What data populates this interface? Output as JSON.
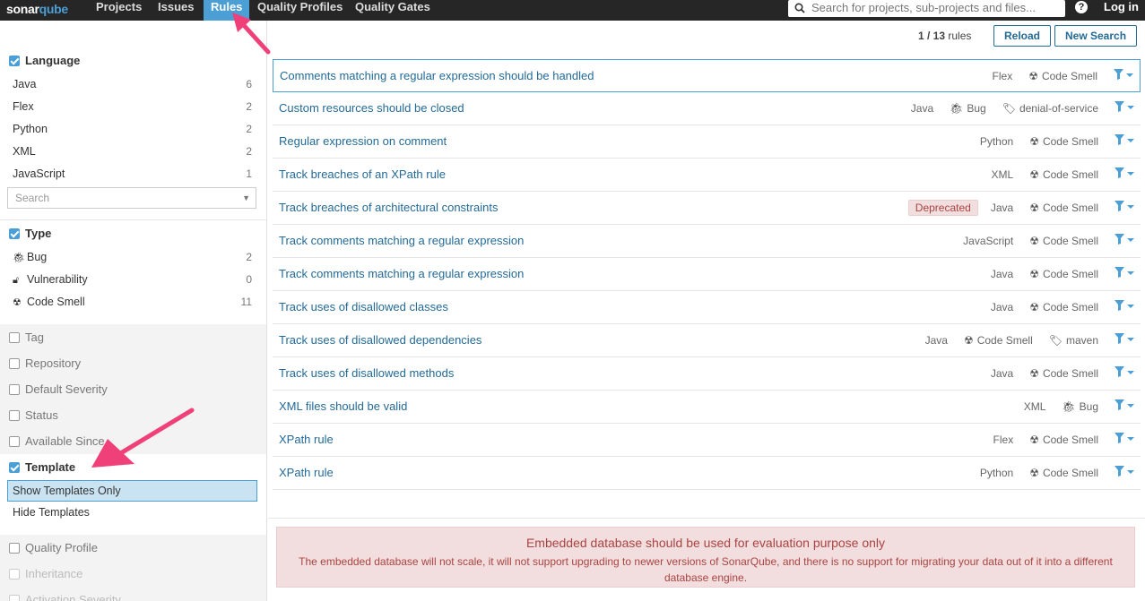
{
  "navbar": {
    "logo_a": "sonar",
    "logo_b": "qube",
    "items": [
      "Projects",
      "Issues",
      "Rules",
      "Quality Profiles",
      "Quality Gates"
    ],
    "active": "Rules",
    "search_placeholder": "Search for projects, sub-projects and files...",
    "help": "?",
    "login": "Log in"
  },
  "toolbar": {
    "count": "1 / 13",
    "count_suffix": "rules",
    "reload": "Reload",
    "new_search": "New Search"
  },
  "sidebar": {
    "language": {
      "title": "Language",
      "items": [
        {
          "label": "Java",
          "count": "6"
        },
        {
          "label": "Flex",
          "count": "2"
        },
        {
          "label": "Python",
          "count": "2"
        },
        {
          "label": "XML",
          "count": "2"
        },
        {
          "label": "JavaScript",
          "count": "1"
        }
      ],
      "search_placeholder": "Search"
    },
    "type": {
      "title": "Type",
      "items": [
        {
          "label": "Bug",
          "count": "2",
          "icon": "bug-icon"
        },
        {
          "label": "Vulnerability",
          "count": "0",
          "icon": "lock-icon"
        },
        {
          "label": "Code Smell",
          "count": "11",
          "icon": "code-smell-icon"
        }
      ]
    },
    "closed_facets": [
      "Tag",
      "Repository",
      "Default Severity",
      "Status",
      "Available Since"
    ],
    "template": {
      "title": "Template",
      "items": [
        "Show Templates Only",
        "Hide Templates"
      ],
      "selected": "Show Templates Only"
    },
    "closed_facets_2": [
      "Quality Profile",
      "Inheritance",
      "Activation Severity"
    ]
  },
  "rules": [
    {
      "name": "Comments matching a regular expression should be handled",
      "lang": "Flex",
      "type": "Code Smell",
      "tag": "",
      "deprecated": ""
    },
    {
      "name": "Custom resources should be closed",
      "lang": "Java",
      "type": "Bug",
      "tag": "denial-of-service",
      "deprecated": ""
    },
    {
      "name": "Regular expression on comment",
      "lang": "Python",
      "type": "Code Smell",
      "tag": "",
      "deprecated": ""
    },
    {
      "name": "Track breaches of an XPath rule",
      "lang": "XML",
      "type": "Code Smell",
      "tag": "",
      "deprecated": ""
    },
    {
      "name": "Track breaches of architectural constraints",
      "lang": "Java",
      "type": "Code Smell",
      "tag": "",
      "deprecated": "Deprecated"
    },
    {
      "name": "Track comments matching a regular expression",
      "lang": "JavaScript",
      "type": "Code Smell",
      "tag": "",
      "deprecated": ""
    },
    {
      "name": "Track comments matching a regular expression",
      "lang": "Java",
      "type": "Code Smell",
      "tag": "",
      "deprecated": ""
    },
    {
      "name": "Track uses of disallowed classes",
      "lang": "Java",
      "type": "Code Smell",
      "tag": "",
      "deprecated": ""
    },
    {
      "name": "Track uses of disallowed dependencies",
      "lang": "Java",
      "type": "Code Smell",
      "tag": "maven",
      "deprecated": ""
    },
    {
      "name": "Track uses of disallowed methods",
      "lang": "Java",
      "type": "Code Smell",
      "tag": "",
      "deprecated": ""
    },
    {
      "name": "XML files should be valid",
      "lang": "XML",
      "type": "Bug",
      "tag": "",
      "deprecated": ""
    },
    {
      "name": "XPath rule",
      "lang": "Flex",
      "type": "Code Smell",
      "tag": "",
      "deprecated": ""
    },
    {
      "name": "XPath rule",
      "lang": "Python",
      "type": "Code Smell",
      "tag": "",
      "deprecated": ""
    }
  ],
  "alert": {
    "title": "Embedded database should be used for evaluation purpose only",
    "body": "The embedded database will not scale, it will not support upgrading to newer versions of SonarQube, and there is no support for migrating your data out of it into a different database engine."
  },
  "colors": {
    "accent": "#4b9fd5",
    "link": "#236a97",
    "annotation_arrow": "#f0407a"
  }
}
